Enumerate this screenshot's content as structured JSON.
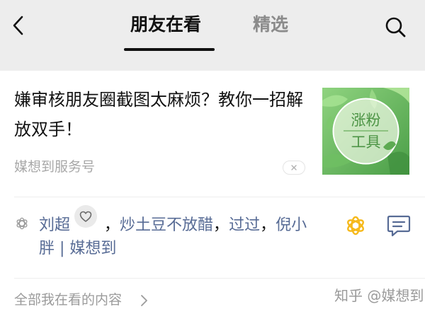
{
  "colors": {
    "header_bg": "#ededed",
    "name_link": "#576b95",
    "wow_icon": "#f6b91b",
    "source_gray": "#a8a8a8"
  },
  "header": {
    "back_icon": "chevron-left-icon",
    "tabs": [
      {
        "label": "朋友在看",
        "active": true
      },
      {
        "label": "精选",
        "active": false
      }
    ],
    "search_icon": "search-icon"
  },
  "article": {
    "title": "嫌审核朋友圈截图太麻烦？教你一招解放双手！",
    "source": "媒想到服务号",
    "dismiss_icon": "close-icon",
    "thumbnail": {
      "line1": "涨粉",
      "line2": "工具"
    }
  },
  "friends": {
    "names": [
      "刘超",
      "炒土豆不放醋",
      "过过",
      "倪小胖",
      "媒想到"
    ],
    "separator": "，",
    "last_separator": " | "
  },
  "footer": {
    "all_link": "全部我在看的内容",
    "watermark": "知乎 @媒想到"
  }
}
